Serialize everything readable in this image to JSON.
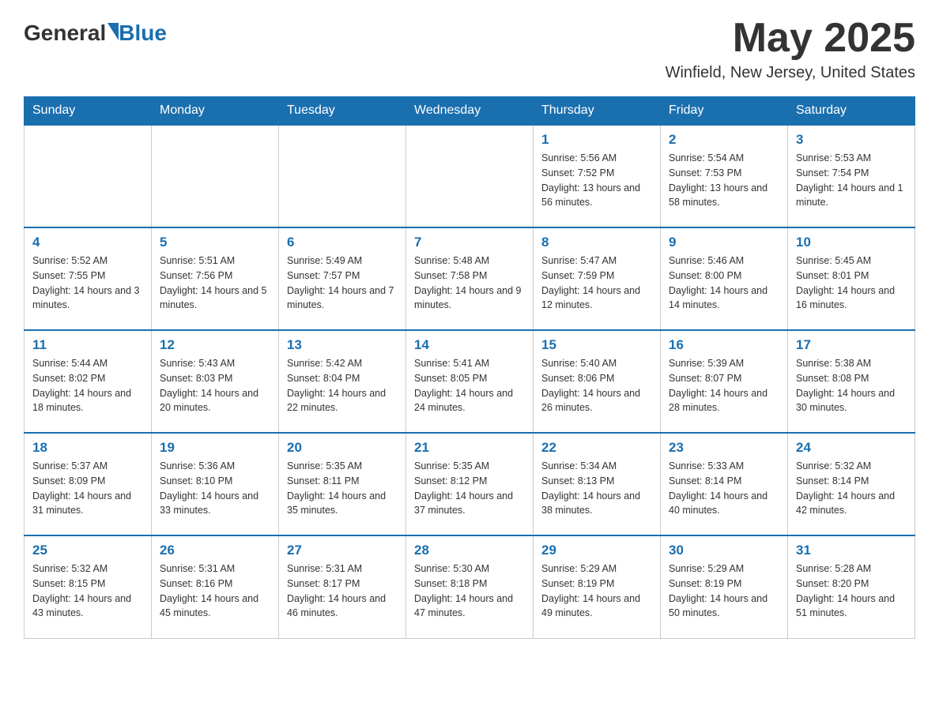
{
  "header": {
    "logo_general": "General",
    "logo_blue": "Blue",
    "title": "May 2025",
    "subtitle": "Winfield, New Jersey, United States"
  },
  "days_of_week": [
    "Sunday",
    "Monday",
    "Tuesday",
    "Wednesday",
    "Thursday",
    "Friday",
    "Saturday"
  ],
  "weeks": [
    [
      {
        "day": "",
        "sunrise": "",
        "sunset": "",
        "daylight": ""
      },
      {
        "day": "",
        "sunrise": "",
        "sunset": "",
        "daylight": ""
      },
      {
        "day": "",
        "sunrise": "",
        "sunset": "",
        "daylight": ""
      },
      {
        "day": "",
        "sunrise": "",
        "sunset": "",
        "daylight": ""
      },
      {
        "day": "1",
        "sunrise": "Sunrise: 5:56 AM",
        "sunset": "Sunset: 7:52 PM",
        "daylight": "Daylight: 13 hours and 56 minutes."
      },
      {
        "day": "2",
        "sunrise": "Sunrise: 5:54 AM",
        "sunset": "Sunset: 7:53 PM",
        "daylight": "Daylight: 13 hours and 58 minutes."
      },
      {
        "day": "3",
        "sunrise": "Sunrise: 5:53 AM",
        "sunset": "Sunset: 7:54 PM",
        "daylight": "Daylight: 14 hours and 1 minute."
      }
    ],
    [
      {
        "day": "4",
        "sunrise": "Sunrise: 5:52 AM",
        "sunset": "Sunset: 7:55 PM",
        "daylight": "Daylight: 14 hours and 3 minutes."
      },
      {
        "day": "5",
        "sunrise": "Sunrise: 5:51 AM",
        "sunset": "Sunset: 7:56 PM",
        "daylight": "Daylight: 14 hours and 5 minutes."
      },
      {
        "day": "6",
        "sunrise": "Sunrise: 5:49 AM",
        "sunset": "Sunset: 7:57 PM",
        "daylight": "Daylight: 14 hours and 7 minutes."
      },
      {
        "day": "7",
        "sunrise": "Sunrise: 5:48 AM",
        "sunset": "Sunset: 7:58 PM",
        "daylight": "Daylight: 14 hours and 9 minutes."
      },
      {
        "day": "8",
        "sunrise": "Sunrise: 5:47 AM",
        "sunset": "Sunset: 7:59 PM",
        "daylight": "Daylight: 14 hours and 12 minutes."
      },
      {
        "day": "9",
        "sunrise": "Sunrise: 5:46 AM",
        "sunset": "Sunset: 8:00 PM",
        "daylight": "Daylight: 14 hours and 14 minutes."
      },
      {
        "day": "10",
        "sunrise": "Sunrise: 5:45 AM",
        "sunset": "Sunset: 8:01 PM",
        "daylight": "Daylight: 14 hours and 16 minutes."
      }
    ],
    [
      {
        "day": "11",
        "sunrise": "Sunrise: 5:44 AM",
        "sunset": "Sunset: 8:02 PM",
        "daylight": "Daylight: 14 hours and 18 minutes."
      },
      {
        "day": "12",
        "sunrise": "Sunrise: 5:43 AM",
        "sunset": "Sunset: 8:03 PM",
        "daylight": "Daylight: 14 hours and 20 minutes."
      },
      {
        "day": "13",
        "sunrise": "Sunrise: 5:42 AM",
        "sunset": "Sunset: 8:04 PM",
        "daylight": "Daylight: 14 hours and 22 minutes."
      },
      {
        "day": "14",
        "sunrise": "Sunrise: 5:41 AM",
        "sunset": "Sunset: 8:05 PM",
        "daylight": "Daylight: 14 hours and 24 minutes."
      },
      {
        "day": "15",
        "sunrise": "Sunrise: 5:40 AM",
        "sunset": "Sunset: 8:06 PM",
        "daylight": "Daylight: 14 hours and 26 minutes."
      },
      {
        "day": "16",
        "sunrise": "Sunrise: 5:39 AM",
        "sunset": "Sunset: 8:07 PM",
        "daylight": "Daylight: 14 hours and 28 minutes."
      },
      {
        "day": "17",
        "sunrise": "Sunrise: 5:38 AM",
        "sunset": "Sunset: 8:08 PM",
        "daylight": "Daylight: 14 hours and 30 minutes."
      }
    ],
    [
      {
        "day": "18",
        "sunrise": "Sunrise: 5:37 AM",
        "sunset": "Sunset: 8:09 PM",
        "daylight": "Daylight: 14 hours and 31 minutes."
      },
      {
        "day": "19",
        "sunrise": "Sunrise: 5:36 AM",
        "sunset": "Sunset: 8:10 PM",
        "daylight": "Daylight: 14 hours and 33 minutes."
      },
      {
        "day": "20",
        "sunrise": "Sunrise: 5:35 AM",
        "sunset": "Sunset: 8:11 PM",
        "daylight": "Daylight: 14 hours and 35 minutes."
      },
      {
        "day": "21",
        "sunrise": "Sunrise: 5:35 AM",
        "sunset": "Sunset: 8:12 PM",
        "daylight": "Daylight: 14 hours and 37 minutes."
      },
      {
        "day": "22",
        "sunrise": "Sunrise: 5:34 AM",
        "sunset": "Sunset: 8:13 PM",
        "daylight": "Daylight: 14 hours and 38 minutes."
      },
      {
        "day": "23",
        "sunrise": "Sunrise: 5:33 AM",
        "sunset": "Sunset: 8:14 PM",
        "daylight": "Daylight: 14 hours and 40 minutes."
      },
      {
        "day": "24",
        "sunrise": "Sunrise: 5:32 AM",
        "sunset": "Sunset: 8:14 PM",
        "daylight": "Daylight: 14 hours and 42 minutes."
      }
    ],
    [
      {
        "day": "25",
        "sunrise": "Sunrise: 5:32 AM",
        "sunset": "Sunset: 8:15 PM",
        "daylight": "Daylight: 14 hours and 43 minutes."
      },
      {
        "day": "26",
        "sunrise": "Sunrise: 5:31 AM",
        "sunset": "Sunset: 8:16 PM",
        "daylight": "Daylight: 14 hours and 45 minutes."
      },
      {
        "day": "27",
        "sunrise": "Sunrise: 5:31 AM",
        "sunset": "Sunset: 8:17 PM",
        "daylight": "Daylight: 14 hours and 46 minutes."
      },
      {
        "day": "28",
        "sunrise": "Sunrise: 5:30 AM",
        "sunset": "Sunset: 8:18 PM",
        "daylight": "Daylight: 14 hours and 47 minutes."
      },
      {
        "day": "29",
        "sunrise": "Sunrise: 5:29 AM",
        "sunset": "Sunset: 8:19 PM",
        "daylight": "Daylight: 14 hours and 49 minutes."
      },
      {
        "day": "30",
        "sunrise": "Sunrise: 5:29 AM",
        "sunset": "Sunset: 8:19 PM",
        "daylight": "Daylight: 14 hours and 50 minutes."
      },
      {
        "day": "31",
        "sunrise": "Sunrise: 5:28 AM",
        "sunset": "Sunset: 8:20 PM",
        "daylight": "Daylight: 14 hours and 51 minutes."
      }
    ]
  ]
}
